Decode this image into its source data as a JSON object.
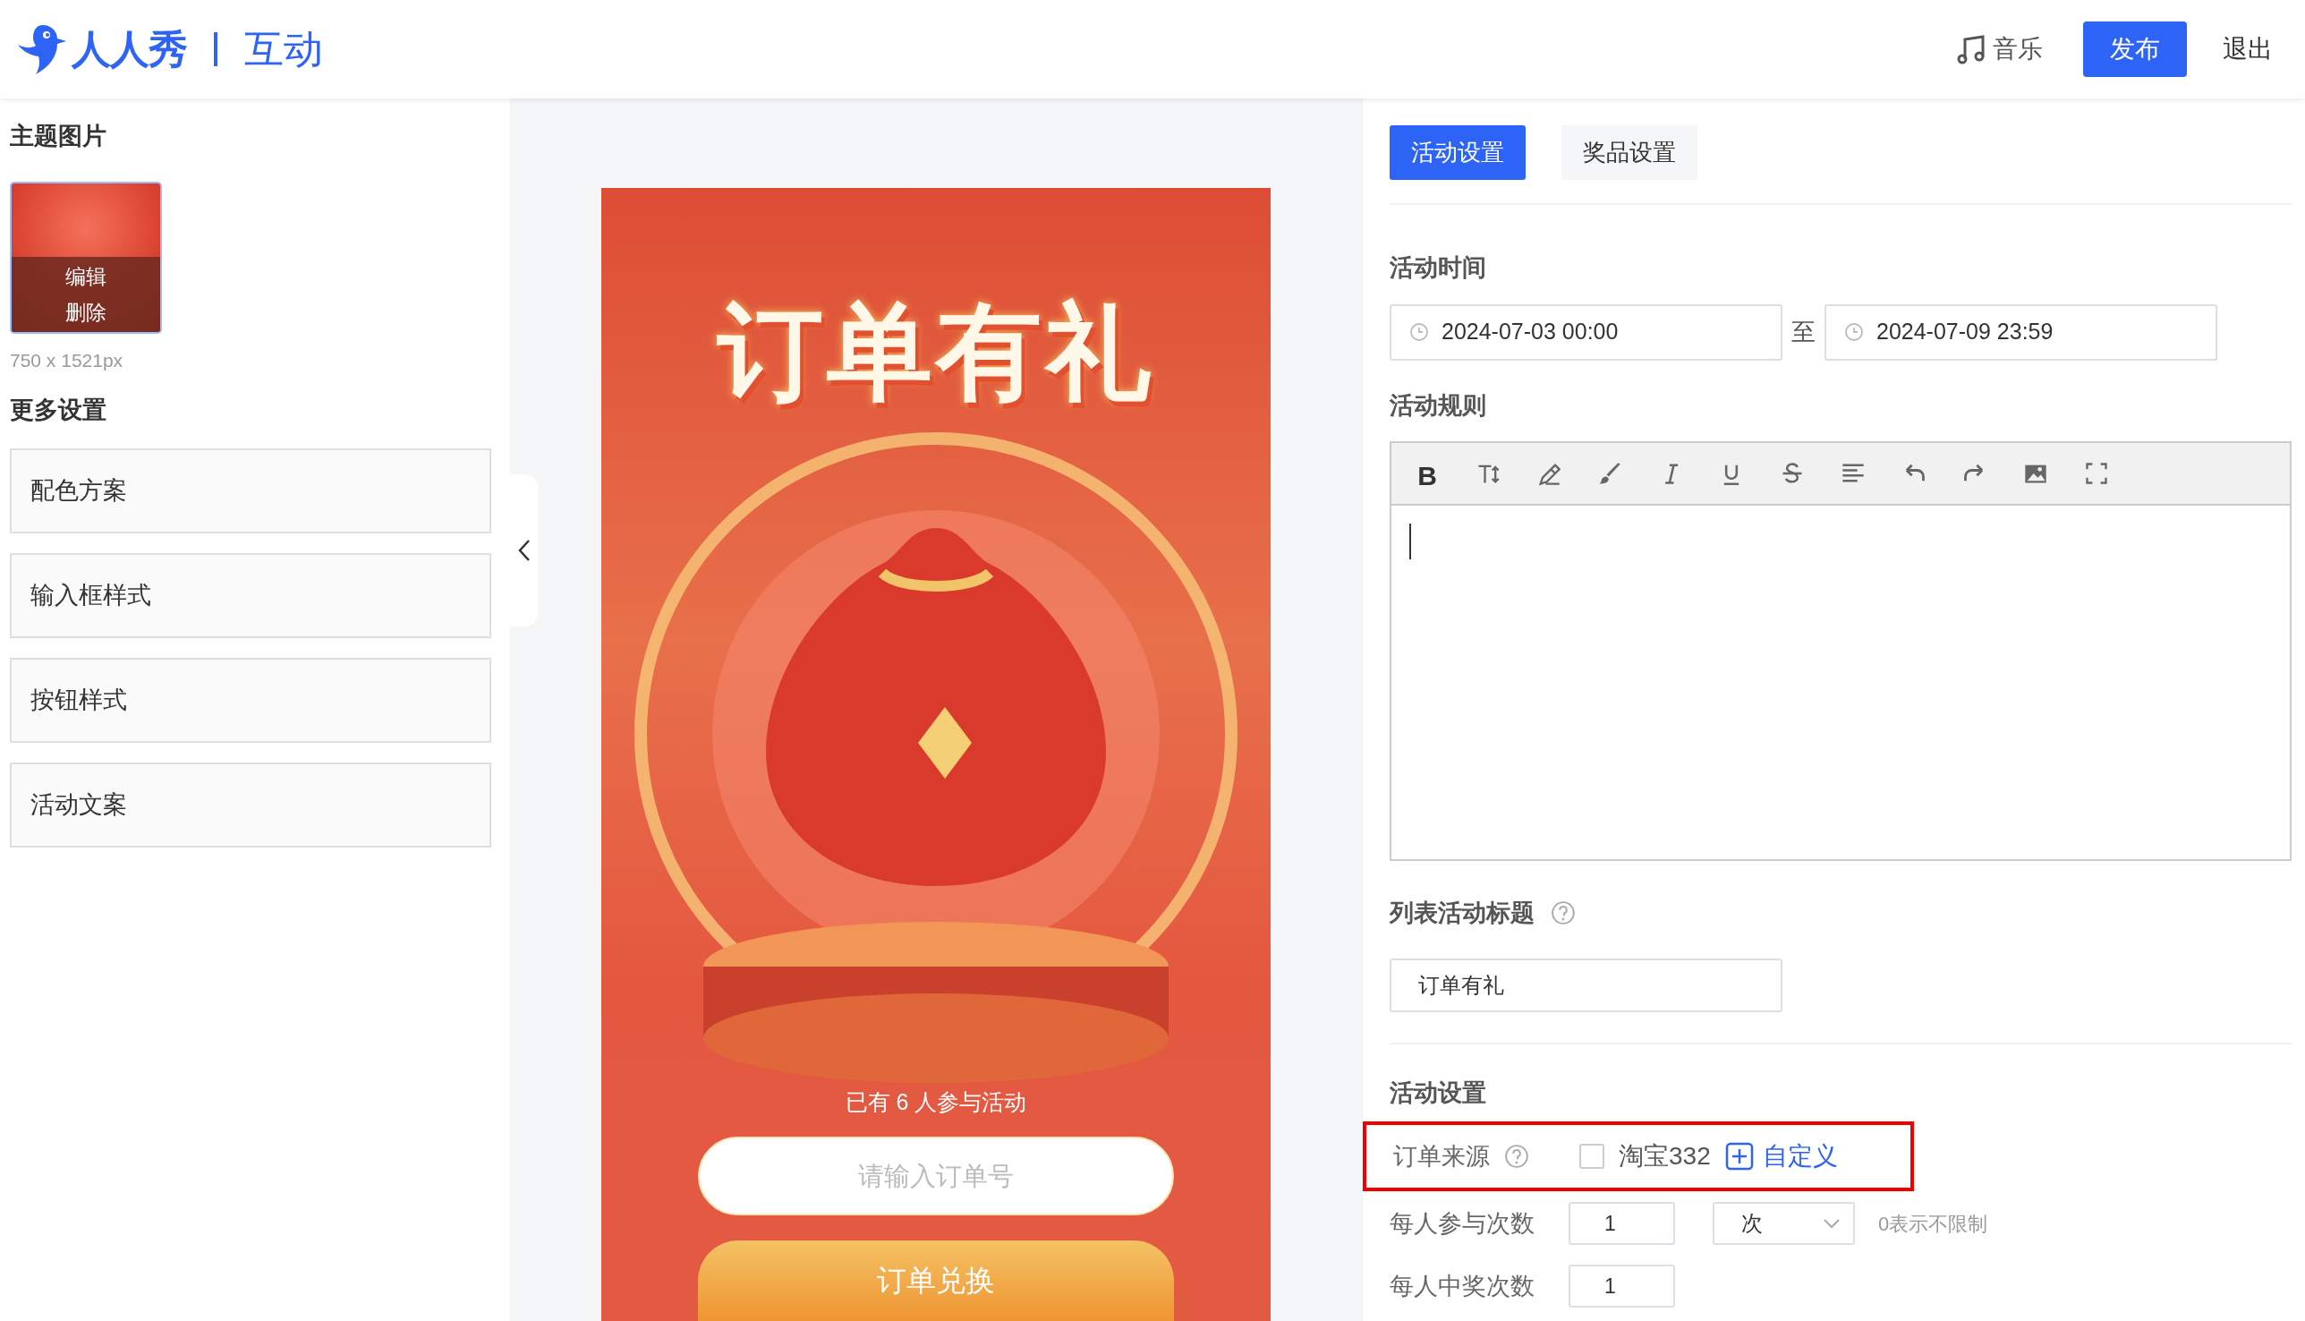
{
  "header": {
    "logo_text": "人人秀",
    "product": "互动",
    "music": "音乐",
    "publish": "发布",
    "logout": "退出"
  },
  "left_panel": {
    "theme_title": "主题图片",
    "thumbnail_actions": [
      "编辑",
      "删除"
    ],
    "image_size": "750 x 1521px",
    "more_title": "更多设置",
    "items": [
      "配色方案",
      "输入框样式",
      "按钮样式",
      "活动文案"
    ]
  },
  "preview": {
    "poster_title": "订单有礼",
    "participants": "已有 6 人参与活动",
    "order_input": {
      "placeholder": "请输入订单号"
    },
    "submit": "订单兑换"
  },
  "right_panel": {
    "tabs": [
      {
        "label": "活动设置",
        "selected": true
      },
      {
        "label": "奖品设置",
        "selected": false
      }
    ],
    "time_label": "活动时间",
    "start": "2024-07-03 00:00",
    "separator": "至",
    "end": "2024-07-09 23:59",
    "rules_label": "活动规则",
    "toolbar": [
      {
        "kind": "bold",
        "label": "B"
      },
      {
        "kind": "text-size"
      },
      {
        "kind": "pen"
      },
      {
        "kind": "brush"
      },
      {
        "kind": "italic"
      },
      {
        "kind": "underline"
      },
      {
        "kind": "strike"
      },
      {
        "kind": "align"
      },
      {
        "kind": "undo"
      },
      {
        "kind": "redo"
      },
      {
        "kind": "image"
      },
      {
        "kind": "fullscreen"
      }
    ],
    "list_title_label": "列表活动标题",
    "list_title_value": "订单有礼",
    "settings_label": "活动设置",
    "order_source": {
      "label": "订单来源",
      "highlighted": true,
      "options": [
        {
          "label": "淘宝332",
          "checked": false
        }
      ],
      "custom": "自定义"
    },
    "rows": [
      {
        "label": "每人参与次数",
        "value": "1",
        "unit": "次",
        "hint": "0表示不限制"
      },
      {
        "label": "每人中奖次数",
        "value": "1"
      }
    ]
  }
}
